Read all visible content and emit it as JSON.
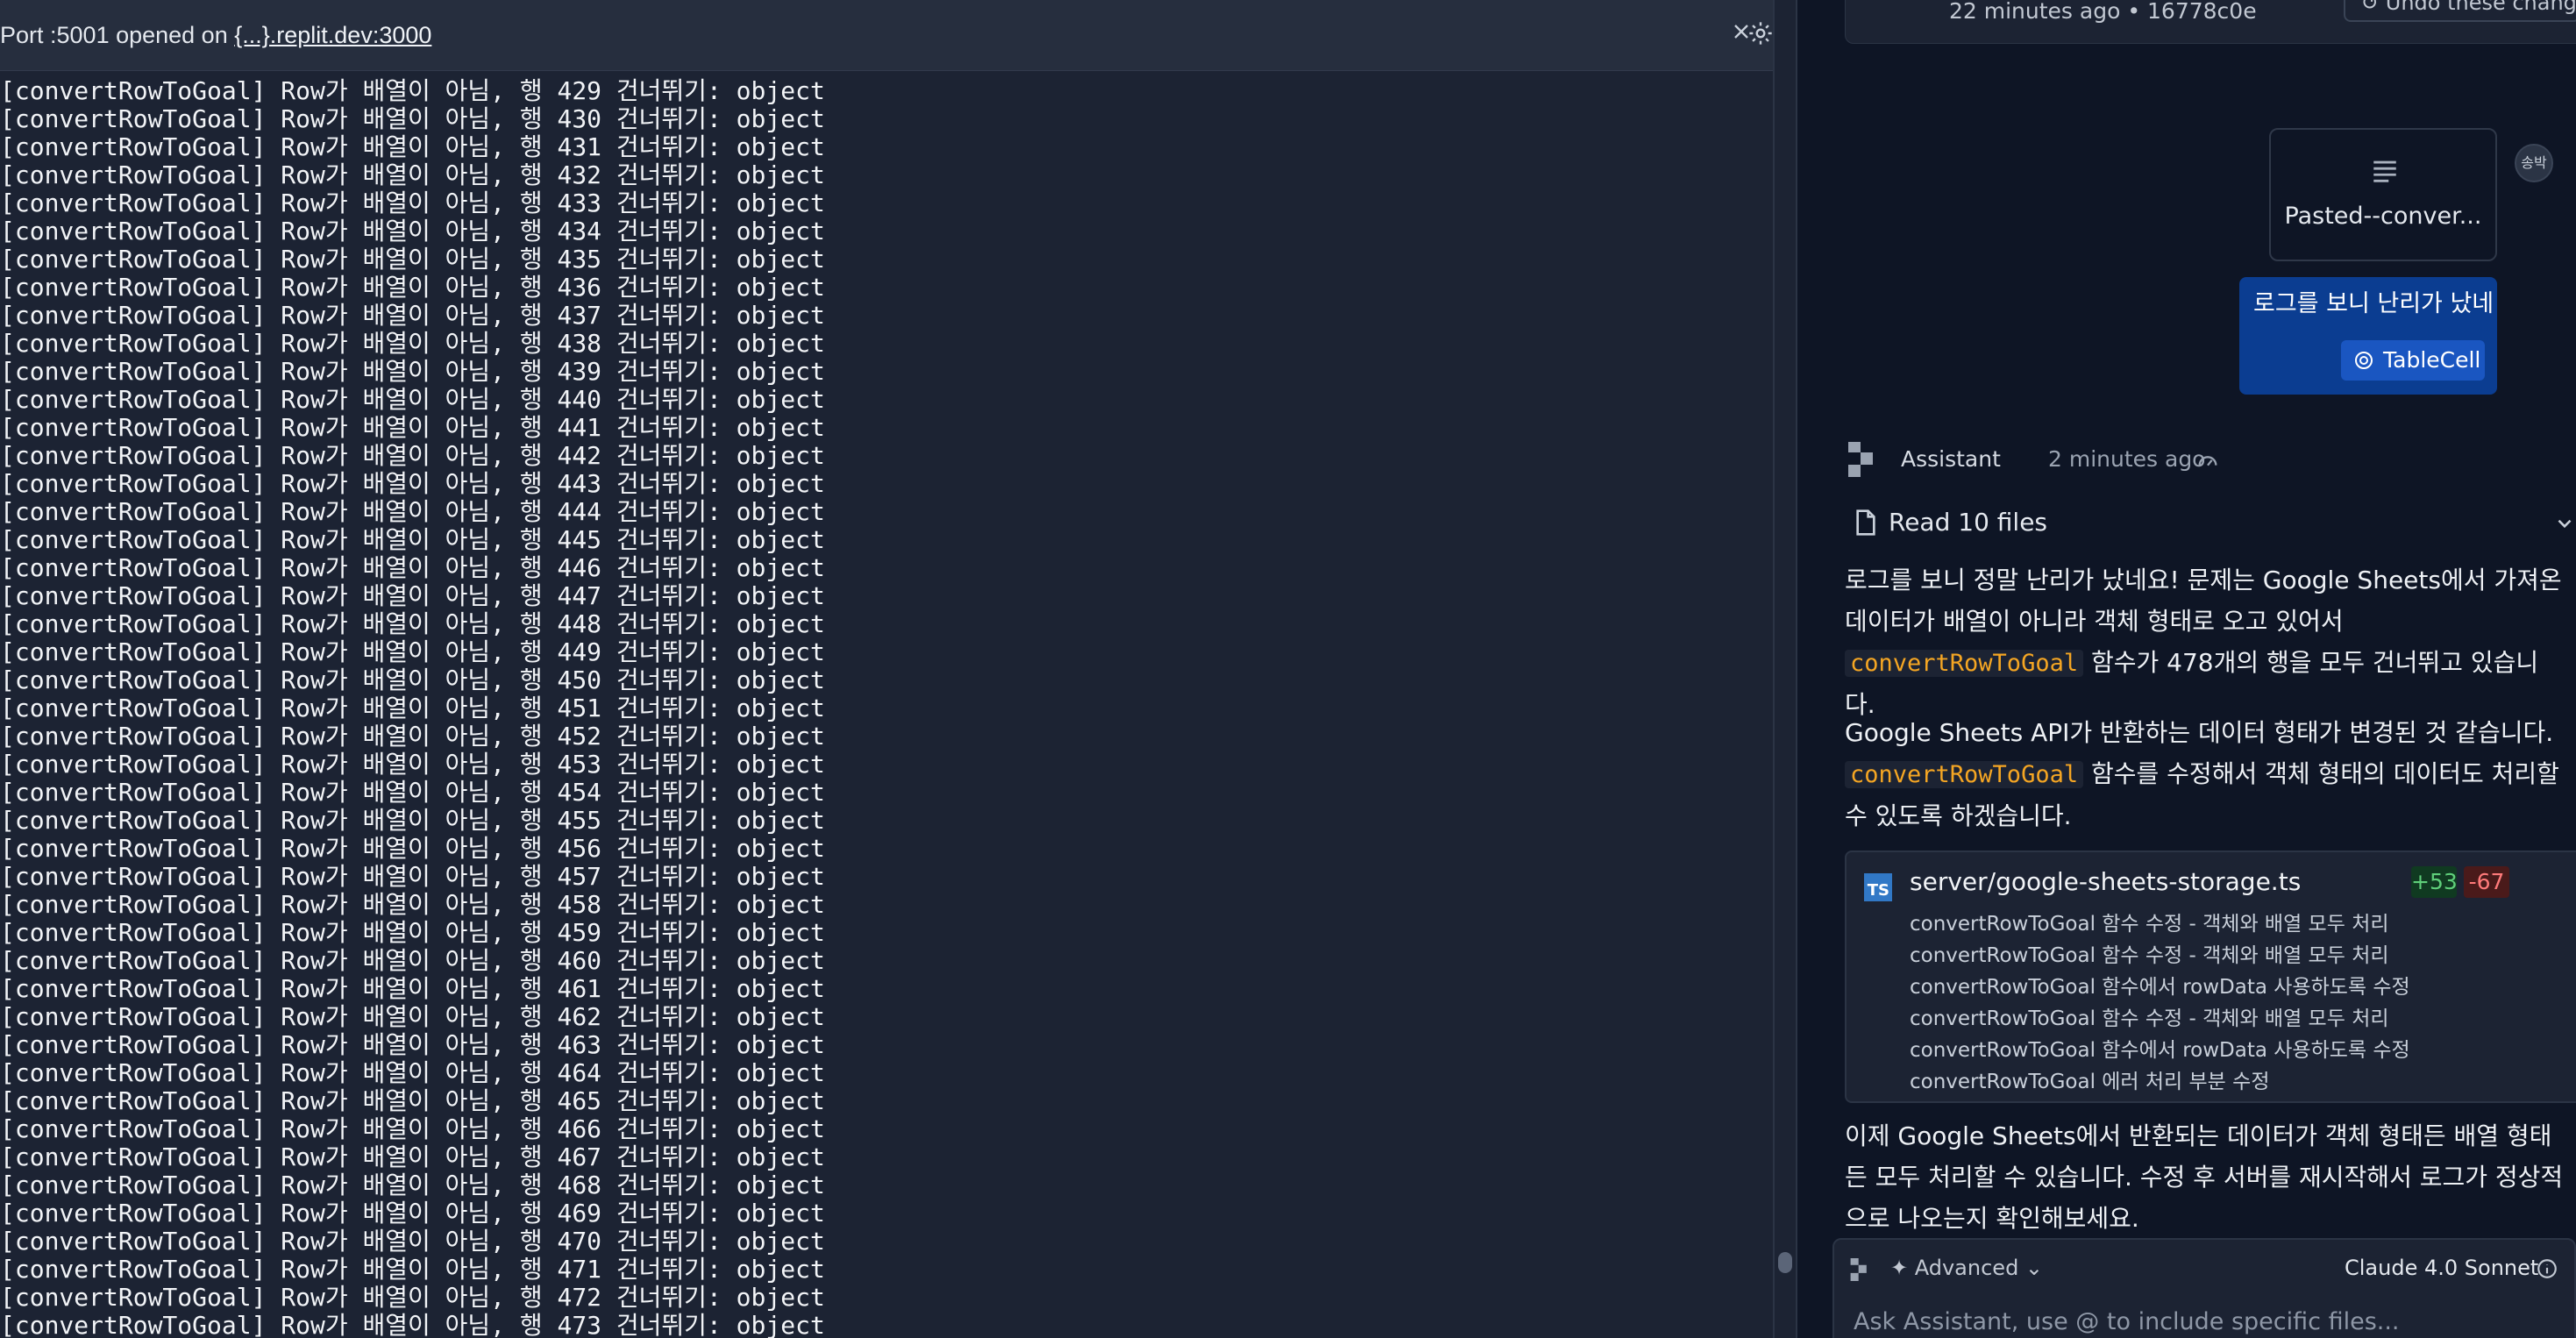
{
  "console": {
    "title_prefix": "Port :5001 opened on ",
    "title_link": "{...}.replit.dev:3000",
    "lines": [
      "[convertRowToGoal] Row가 배열이 아님, 행 429 건너뛰기: object",
      "[convertRowToGoal] Row가 배열이 아님, 행 430 건너뛰기: object",
      "[convertRowToGoal] Row가 배열이 아님, 행 431 건너뛰기: object",
      "[convertRowToGoal] Row가 배열이 아님, 행 432 건너뛰기: object",
      "[convertRowToGoal] Row가 배열이 아님, 행 433 건너뛰기: object",
      "[convertRowToGoal] Row가 배열이 아님, 행 434 건너뛰기: object",
      "[convertRowToGoal] Row가 배열이 아님, 행 435 건너뛰기: object",
      "[convertRowToGoal] Row가 배열이 아님, 행 436 건너뛰기: object",
      "[convertRowToGoal] Row가 배열이 아님, 행 437 건너뛰기: object",
      "[convertRowToGoal] Row가 배열이 아님, 행 438 건너뛰기: object",
      "[convertRowToGoal] Row가 배열이 아님, 행 439 건너뛰기: object",
      "[convertRowToGoal] Row가 배열이 아님, 행 440 건너뛰기: object",
      "[convertRowToGoal] Row가 배열이 아님, 행 441 건너뛰기: object",
      "[convertRowToGoal] Row가 배열이 아님, 행 442 건너뛰기: object",
      "[convertRowToGoal] Row가 배열이 아님, 행 443 건너뛰기: object",
      "[convertRowToGoal] Row가 배열이 아님, 행 444 건너뛰기: object",
      "[convertRowToGoal] Row가 배열이 아님, 행 445 건너뛰기: object",
      "[convertRowToGoal] Row가 배열이 아님, 행 446 건너뛰기: object",
      "[convertRowToGoal] Row가 배열이 아님, 행 447 건너뛰기: object",
      "[convertRowToGoal] Row가 배열이 아님, 행 448 건너뛰기: object",
      "[convertRowToGoal] Row가 배열이 아님, 행 449 건너뛰기: object",
      "[convertRowToGoal] Row가 배열이 아님, 행 450 건너뛰기: object",
      "[convertRowToGoal] Row가 배열이 아님, 행 451 건너뛰기: object",
      "[convertRowToGoal] Row가 배열이 아님, 행 452 건너뛰기: object",
      "[convertRowToGoal] Row가 배열이 아님, 행 453 건너뛰기: object",
      "[convertRowToGoal] Row가 배열이 아님, 행 454 건너뛰기: object",
      "[convertRowToGoal] Row가 배열이 아님, 행 455 건너뛰기: object",
      "[convertRowToGoal] Row가 배열이 아님, 행 456 건너뛰기: object",
      "[convertRowToGoal] Row가 배열이 아님, 행 457 건너뛰기: object",
      "[convertRowToGoal] Row가 배열이 아님, 행 458 건너뛰기: object",
      "[convertRowToGoal] Row가 배열이 아님, 행 459 건너뛰기: object",
      "[convertRowToGoal] Row가 배열이 아님, 행 460 건너뛰기: object",
      "[convertRowToGoal] Row가 배열이 아님, 행 461 건너뛰기: object",
      "[convertRowToGoal] Row가 배열이 아님, 행 462 건너뛰기: object",
      "[convertRowToGoal] Row가 배열이 아님, 행 463 건너뛰기: object",
      "[convertRowToGoal] Row가 배열이 아님, 행 464 건너뛰기: object",
      "[convertRowToGoal] Row가 배열이 아님, 행 465 건너뛰기: object",
      "[convertRowToGoal] Row가 배열이 아님, 행 466 건너뛰기: object",
      "[convertRowToGoal] Row가 배열이 아님, 행 467 건너뛰기: object",
      "[convertRowToGoal] Row가 배열이 아님, 행 468 건너뛰기: object",
      "[convertRowToGoal] Row가 배열이 아님, 행 469 건너뛰기: object",
      "[convertRowToGoal] Row가 배열이 아님, 행 470 건너뛰기: object",
      "[convertRowToGoal] Row가 배열이 아님, 행 471 건너뛰기: object",
      "[convertRowToGoal] Row가 배열이 아님, 행 472 건너뛰기: object",
      "[convertRowToGoal] Row가 배열이 아님, 행 473 건너뛰기: object"
    ],
    "icons": [
      "gear-icon",
      "no-preview-icon",
      "close-icon"
    ]
  },
  "checkpoint": {
    "time": "22 minutes ago",
    "separator": " • ",
    "commit": "16778c0e",
    "undo_label": "Undo these changes"
  },
  "attachment": {
    "name": "Pasted--conver..."
  },
  "user": {
    "avatar_text": "송박",
    "message": "로그를 보니 난리가 났네",
    "chip_label": "TableCell"
  },
  "assistant": {
    "name": "Assistant",
    "time": "2 minutes ago",
    "read_files_label": "Read 10 files",
    "para1_a": "로그를 보니 정말 난리가 났네요! 문제는 Google Sheets에서 가져온 데이터가 배열이 아니라 객체 형태로 오고 있어서 ",
    "para1_code": "convertRowToGoal",
    "para1_b": " 함수가 478개의 행을 모두 건너뛰고 있습니다.",
    "para2_a": "Google Sheets API가 반환하는 데이터 형태가 변경된 것 같습니다. ",
    "para2_code": "convertRowToGoal",
    "para2_b": " 함수를 수정해서 객체 형태의 데이터도 처리할 수 있도록 하겠습니다.",
    "para3": "이제 Google Sheets에서 반환되는 데이터가 객체 형태든 배열 형태든 모두 처리할 수 있습니다. 수정 후 서버를 재시작해서 로그가 정상적으로 나오는지 확인해보세요."
  },
  "file_change": {
    "icon_text": "TS",
    "path": "server/google-sheets-storage.ts",
    "additions": "+53",
    "deletions": "-67",
    "changes": [
      "convertRowToGoal 함수 수정 - 객체와 배열 모두 처리",
      "convertRowToGoal 함수 수정 - 객체와 배열 모두 처리",
      "convertRowToGoal 함수에서 rowData 사용하도록 수정",
      "convertRowToGoal 함수 수정 - 객체와 배열 모두 처리",
      "convertRowToGoal 함수에서 rowData 사용하도록 수정",
      "convertRowToGoal 에러 처리 부분 수정"
    ]
  },
  "composer": {
    "advanced_label": "Advanced",
    "model": "Claude 4.0 Sonnet",
    "placeholder": "Ask Assistant, use @ to include specific files..."
  },
  "colors": {
    "console_bg": "#1c2333",
    "panel_bg": "#0e1525",
    "user_bubble": "#0b3d91",
    "code_accent": "#f5a623",
    "additions": "#5fcf7a",
    "deletions": "#ff7a7a"
  }
}
